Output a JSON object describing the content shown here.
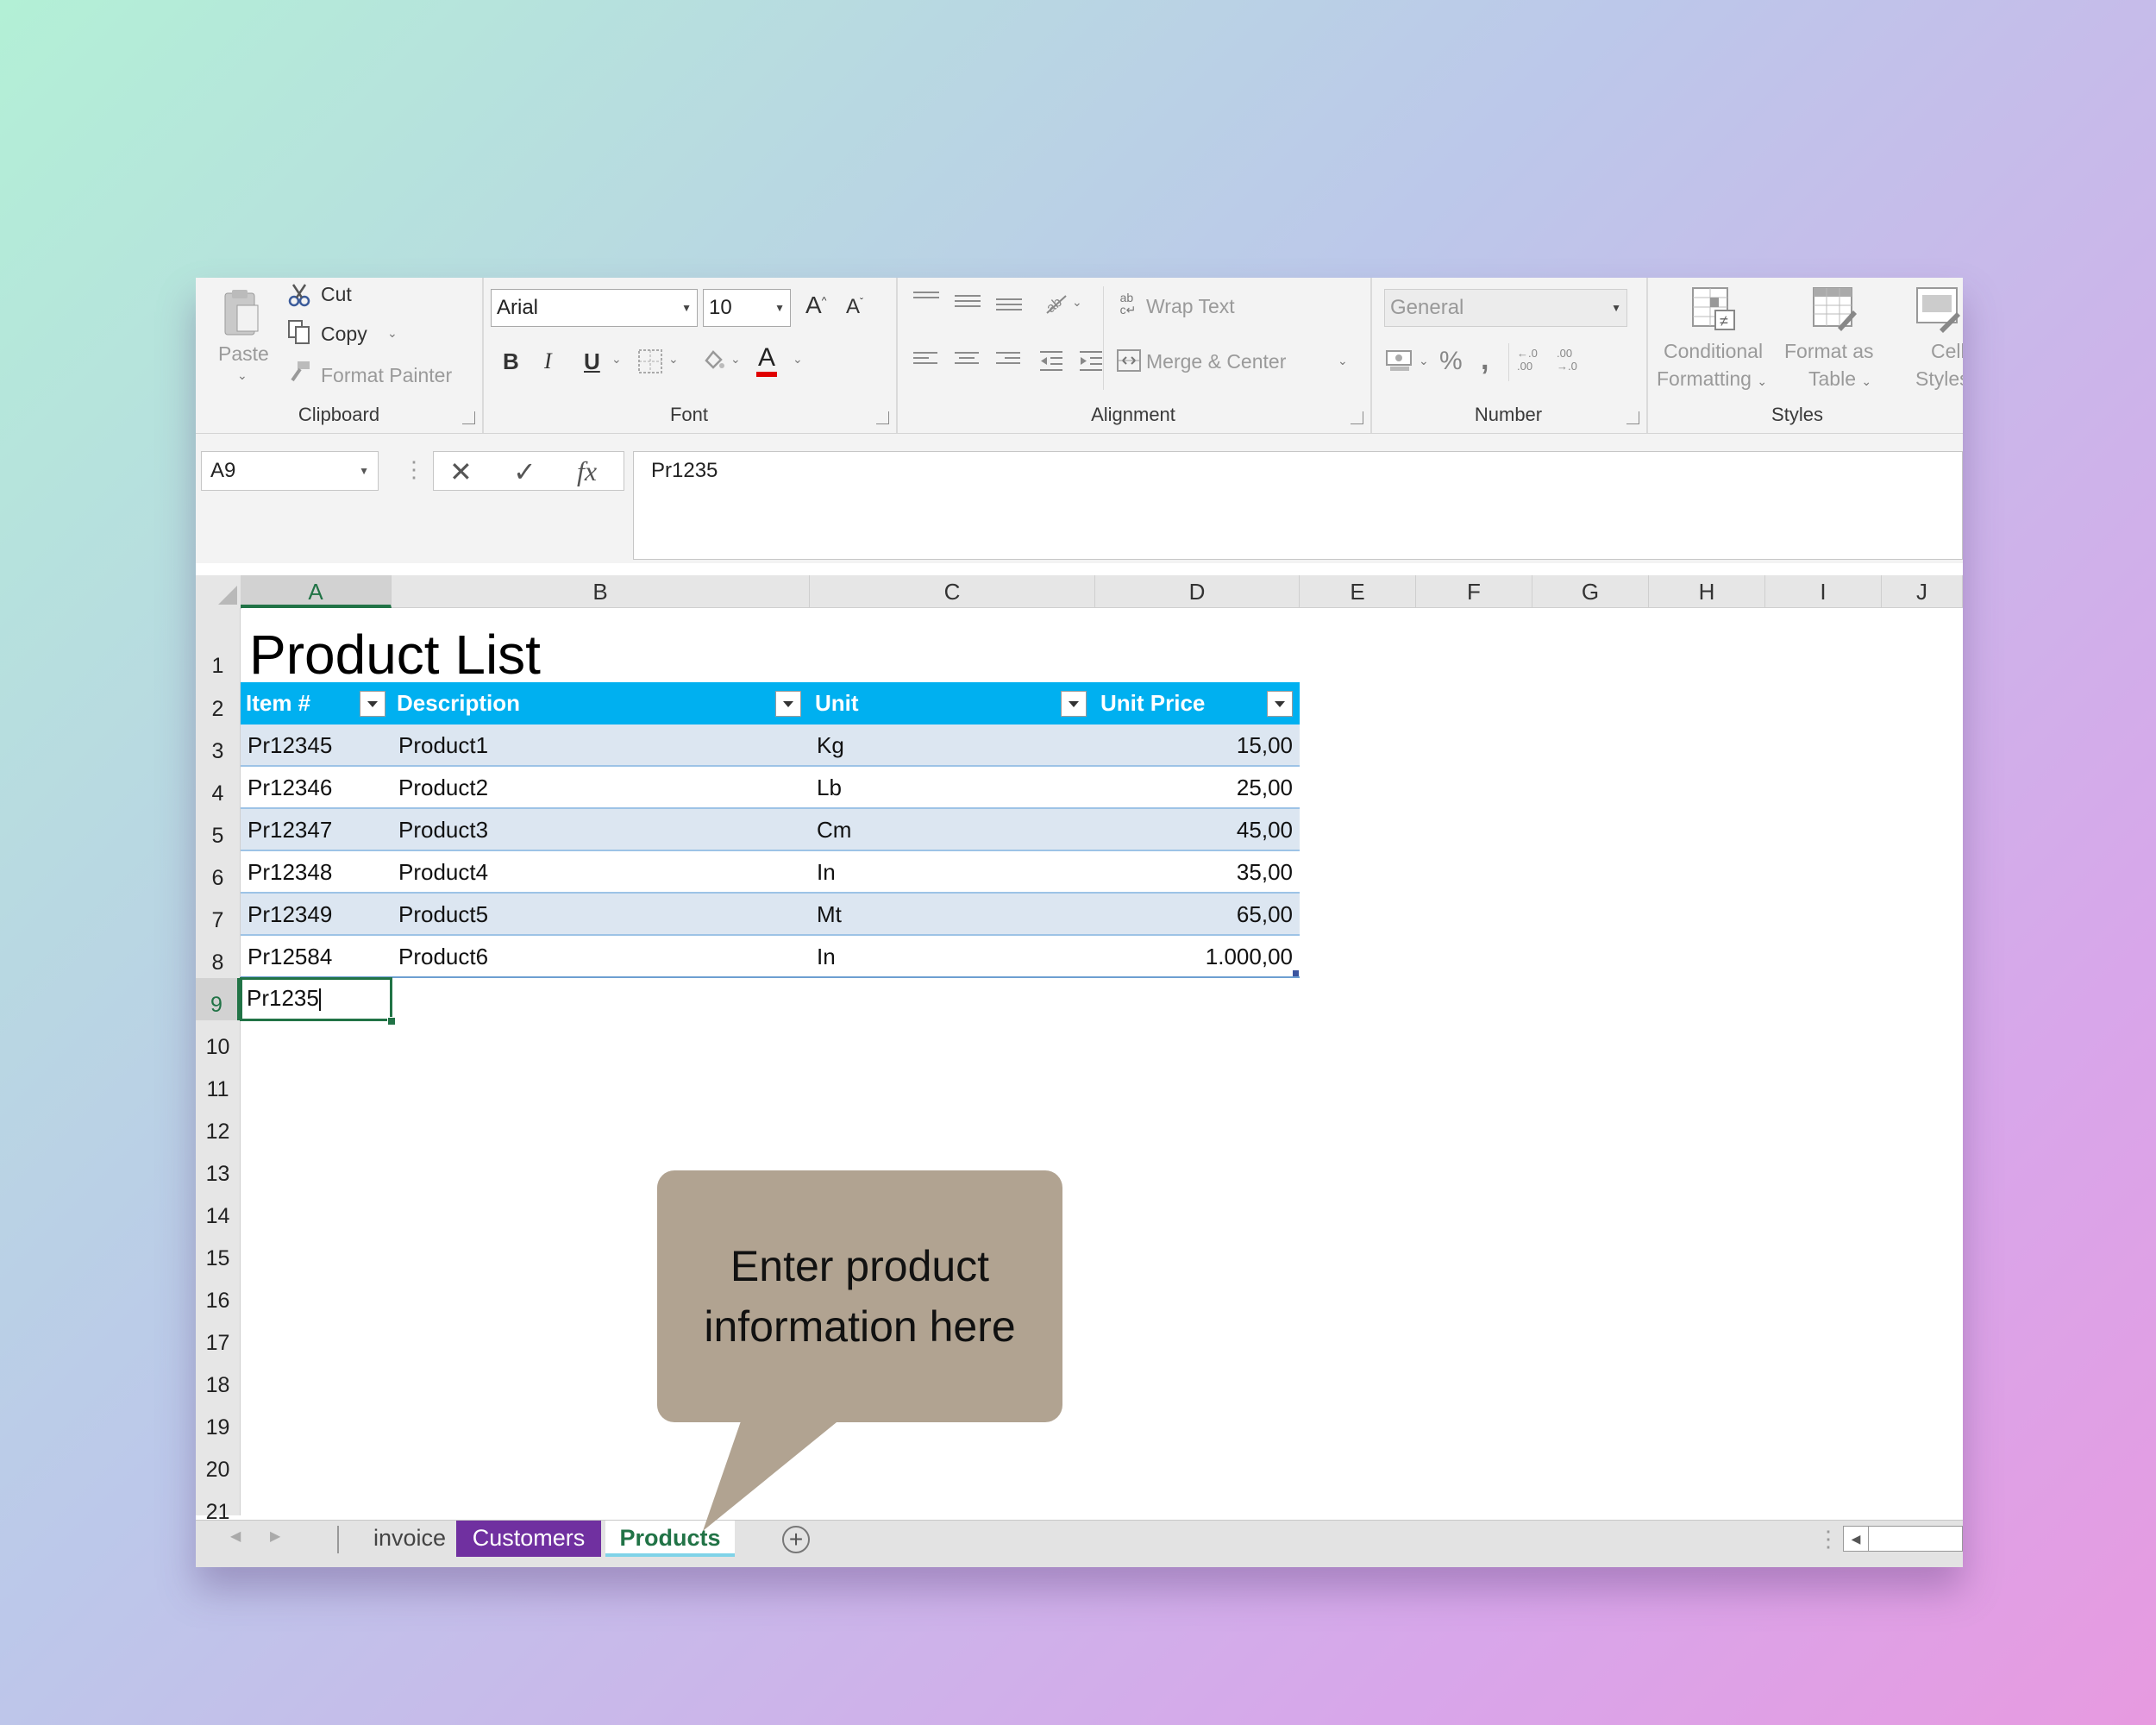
{
  "ribbon": {
    "clipboard": {
      "paste": "Paste",
      "cut": "Cut",
      "copy": "Copy",
      "format_painter": "Format Painter",
      "label": "Clipboard"
    },
    "font": {
      "name": "Arial",
      "size": "10",
      "bold": "B",
      "italic": "I",
      "underline": "U",
      "font_color_letter": "A",
      "grow": "A",
      "shrink": "A",
      "label": "Font"
    },
    "alignment": {
      "wrap_text": "Wrap Text",
      "merge_center": "Merge & Center",
      "label": "Alignment"
    },
    "number": {
      "format": "General",
      "percent": "%",
      "comma": ",",
      "inc_decimal": "←.0 .00",
      "dec_decimal": ".00 →.0",
      "label": "Number"
    },
    "styles": {
      "conditional_1": "Conditional",
      "conditional_2": "Formatting",
      "format_as_1": "Format as",
      "format_as_2": "Table",
      "cell_1": "Cell",
      "cell_2": "Styles",
      "label": "Styles"
    }
  },
  "formula_bar": {
    "name_box": "A9",
    "cancel": "✕",
    "enter": "✓",
    "fx": "fx",
    "value": "Pr1235"
  },
  "columns": [
    "A",
    "B",
    "C",
    "D",
    "E",
    "F",
    "G",
    "H",
    "I",
    "J"
  ],
  "rows": [
    "1",
    "2",
    "3",
    "4",
    "5",
    "6",
    "7",
    "8",
    "9",
    "10",
    "11",
    "12",
    "13",
    "14",
    "15",
    "16",
    "17",
    "18",
    "19",
    "20",
    "21"
  ],
  "sheet": {
    "title": "Product List",
    "headers": [
      "Item #",
      "Description",
      "Unit",
      "Unit Price"
    ],
    "items": [
      {
        "item": "Pr12345",
        "desc": "Product1",
        "unit": "Kg",
        "price": "15,00"
      },
      {
        "item": "Pr12346",
        "desc": "Product2",
        "unit": "Lb",
        "price": "25,00"
      },
      {
        "item": "Pr12347",
        "desc": "Product3",
        "unit": "Cm",
        "price": "45,00"
      },
      {
        "item": "Pr12348",
        "desc": "Product4",
        "unit": "In",
        "price": "35,00"
      },
      {
        "item": "Pr12349",
        "desc": "Product5",
        "unit": "Mt",
        "price": "65,00"
      },
      {
        "item": "Pr12584",
        "desc": "Product6",
        "unit": "In",
        "price": "1.000,00"
      }
    ],
    "editing_cell_value": "Pr1235"
  },
  "tabs": [
    {
      "label": "invoice",
      "color": "#e3e3e3"
    },
    {
      "label": "Customers",
      "color": "#7030a0"
    },
    {
      "label": "Products",
      "color": "#ffffff"
    }
  ],
  "callout": {
    "text": "Enter product information here",
    "color": "#b1a391"
  },
  "colors": {
    "table_header": "#00b0f0",
    "table_band": "#dce6f1",
    "accent": "#217346"
  }
}
